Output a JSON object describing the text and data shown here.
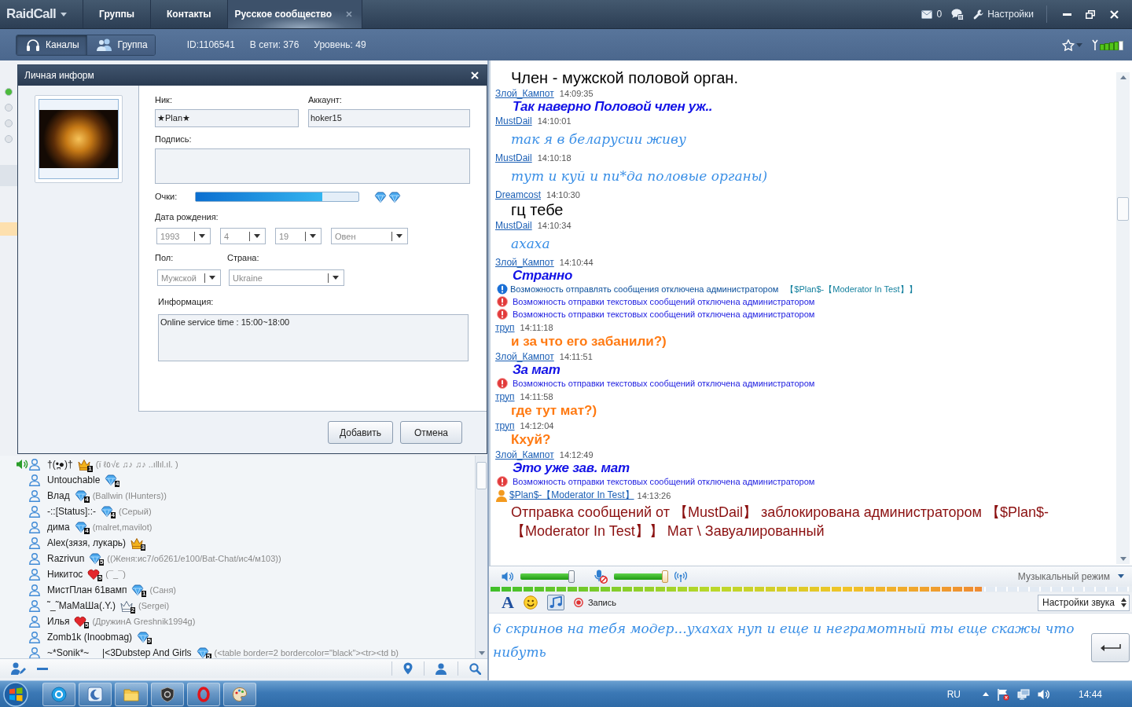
{
  "title_bar": {
    "app_name": "RaidCall",
    "tabs": [
      {
        "label": "Группы",
        "selected": false,
        "closable": false
      },
      {
        "label": "Контакты",
        "selected": false,
        "closable": false
      },
      {
        "label": "Русское сообщество",
        "selected": true,
        "closable": true
      }
    ],
    "mail_count": "0",
    "settings_label": "Настройки"
  },
  "toolbar": {
    "view_tabs": [
      {
        "label": "Каналы",
        "selected": true
      },
      {
        "label": "Группа",
        "selected": false
      }
    ],
    "stats": [
      "ID:1106541",
      "В сети: 376",
      "Уровень: 49"
    ]
  },
  "channel_tree": {
    "rows": [
      {
        "kind": "dot",
        "color": "#4cbb3c"
      },
      {
        "kind": "dot",
        "color": "#dfe3e8"
      },
      {
        "kind": "dot",
        "color": "#dfe3e8"
      },
      {
        "kind": "dot",
        "color": "#dfe3e8"
      },
      {
        "kind": "band",
        "selected": false
      },
      {
        "kind": "band",
        "selected": true
      }
    ]
  },
  "profile_dialog": {
    "title": "Личная информ",
    "nick_label": "Ник:",
    "nick": "★Plan★",
    "account_label": "Аккаунт:",
    "account": "hoker15",
    "signature_label": "Подпись:",
    "points_label": "Очки:",
    "points": {
      "level": 0.78
    },
    "birth_label": "Дата рождения:",
    "birth_fields": [
      {
        "value": "1993",
        "disabled": true
      },
      {
        "value": "4",
        "disabled": true
      },
      {
        "value": "19",
        "disabled": true
      },
      {
        "value": "Овен",
        "disabled": true
      }
    ],
    "gender_label": "Пол:",
    "gender": {
      "value": "Мужской",
      "disabled": true
    },
    "country_label": "Страна:",
    "country": {
      "value": "Ukraine",
      "disabled": true
    },
    "info_label": "Информация:",
    "info": "Online service time : 15:00~18:00",
    "buttons": [
      "Добавить",
      "Отмена"
    ]
  },
  "members": [
    {
      "name": "†(•̪●)†",
      "kind": "crown",
      "badge_number": "1",
      "note": "(ї ℓ٥√ε ♫♪ ♫♪ ..ıllıl.ıl. )",
      "speaking": true
    },
    {
      "name": "Untouchable",
      "kind": "diamond",
      "badge_number": "4",
      "speaking": false
    },
    {
      "name": "Влад",
      "kind": "diamond",
      "badge_number": "4",
      "note": "(Ballwin (IHunters))",
      "speaking": false
    },
    {
      "name": "-::[Status]::-",
      "kind": "diamond",
      "badge_number": "4",
      "note": "(Серый)",
      "speaking": false
    },
    {
      "name": "дима",
      "kind": "diamond",
      "badge_number": "4",
      "note": "(malret,mavilot)",
      "speaking": false
    },
    {
      "name": "Alex(зязя, лукарь)",
      "kind": "crown",
      "badge_number": "3",
      "speaking": false
    },
    {
      "name": "Razrivun",
      "kind": "diamond",
      "badge_number": "5",
      "note": "((Женя:ис7/об261/е100/Bat-Chat/ис4/м103))",
      "speaking": false
    },
    {
      "name": "Никитос",
      "kind": "heart",
      "badge_number": "5",
      "note": "(¯_¯)",
      "speaking": false
    },
    {
      "name": "МистПлан 61вамп",
      "kind": "diamond",
      "badge_number": "1",
      "note": "(Саня)",
      "speaking": false
    },
    {
      "name": "˜_˜МаМаШа(.Y.)",
      "kind": "silver",
      "badge_number": "2",
      "note": "(Sergei)",
      "speaking": false
    },
    {
      "name": "Илья",
      "kind": "heart",
      "badge_number": "5",
      "note": "(ДружинА Greshnik1994g)",
      "speaking": false
    },
    {
      "name": "Zomb1k (Inoobmag)",
      "kind": "diamond",
      "badge_number": "5",
      "speaking": false
    },
    {
      "name": "~*Sonik*~     |<3Dubstep And Girls",
      "kind": "diamond",
      "badge_number": "5",
      "note": "(<table border=2 bordercolor=\"black\"><tr><td b)",
      "speaking": false
    }
  ],
  "chat": {
    "messages": [
      {
        "kind": "plain",
        "text": "Член - мужской половой орган."
      },
      {
        "kind": "header",
        "sender": "Злой_Кампот",
        "time": "14:09:35",
        "moderator": false
      },
      {
        "kind": "emphatic",
        "text": "Так наверно Половой член уж.."
      },
      {
        "kind": "header",
        "sender": "MustDail",
        "time": "14:10:01",
        "moderator": false
      },
      {
        "kind": "script",
        "text": "так я в беларусии живу"
      },
      {
        "kind": "header",
        "sender": "MustDail",
        "time": "14:10:18",
        "moderator": false
      },
      {
        "kind": "script",
        "text": "тут и куй и пи*да половые органы)"
      },
      {
        "kind": "header",
        "sender": "Dreamcost",
        "time": "14:10:30",
        "moderator": false
      },
      {
        "kind": "plain",
        "text": "гц тебе"
      },
      {
        "kind": "header",
        "sender": "MustDail",
        "time": "14:10:34",
        "moderator": false
      },
      {
        "kind": "script",
        "text": "ахаха"
      },
      {
        "kind": "header",
        "sender": "Злой_Кампот",
        "time": "14:10:44",
        "moderator": false
      },
      {
        "kind": "emphatic",
        "text": "Странно"
      },
      {
        "kind": "info",
        "text": "Возможность отправлять сообщения отключена администратором",
        "tag": "【$Plan$-【Moderator In Test】】"
      },
      {
        "kind": "warning",
        "text": "Возможность отправки текстовых сообщений отключена администратором"
      },
      {
        "kind": "warning",
        "text": "Возможность отправки текстовых сообщений отключена администратором"
      },
      {
        "kind": "header",
        "sender": "труп",
        "time": "14:11:18",
        "moderator": false
      },
      {
        "kind": "loud",
        "text": "и за что его забанили?)"
      },
      {
        "kind": "header",
        "sender": "Злой_Кампот",
        "time": "14:11:51",
        "moderator": false
      },
      {
        "kind": "emphatic",
        "text": "За мат"
      },
      {
        "kind": "warning",
        "text": "Возможность отправки текстовых сообщений отключена администратором"
      },
      {
        "kind": "header",
        "sender": "труп",
        "time": "14:11:58",
        "moderator": false
      },
      {
        "kind": "loud",
        "text": "где тут мат?)"
      },
      {
        "kind": "header",
        "sender": "труп",
        "time": "14:12:04",
        "moderator": false
      },
      {
        "kind": "loud",
        "text": "Кхуй?"
      },
      {
        "kind": "header",
        "sender": "Злой_Кампот",
        "time": "14:12:49",
        "moderator": false
      },
      {
        "kind": "emphatic",
        "text": "Это уже зав. мат"
      },
      {
        "kind": "warning",
        "text": "Возможность отправки текстовых сообщений отключена администратором"
      },
      {
        "kind": "header",
        "sender": "$Plan$-【Moderator In Test】",
        "time": "14:13:26",
        "moderator": true
      },
      {
        "kind": "alert",
        "text": "Отправка сообщений от 【MustDail】 заблокирована администратором 【$Plan$-【Moderator In Test】】 Мат \\ Завуалированный"
      }
    ]
  },
  "voice_bar": {
    "speaker_volume": {
      "level": 0.95
    },
    "mic_volume": {
      "level": 0.95
    },
    "mode_label": "Музыкальный режим",
    "input_meter": {
      "level": 0.77
    }
  },
  "compose": {
    "font_glyph": "A",
    "music_button": {
      "on": true
    },
    "record_label": "Запись",
    "sound_settings": "Настройки звука",
    "text": "6 скринов на тебя модер...ухахах нуп и еще и неграмотный ты еще скажы что нибуть"
  },
  "taskbar": {
    "language": "RU",
    "clock": "14:44"
  }
}
